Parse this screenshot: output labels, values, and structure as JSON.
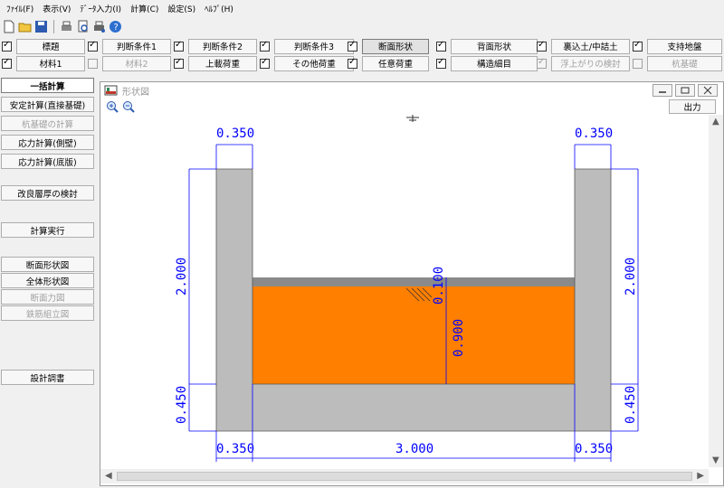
{
  "menu": [
    "ﾌｧｲﾙ(F)",
    "表示(V)",
    "ﾃﾞｰﾀ入力(I)",
    "計算(C)",
    "設定(S)",
    "ﾍﾙﾌﾟ(H)"
  ],
  "toolbar_icons": [
    "new-file-icon",
    "open-folder-icon",
    "save-icon",
    "print-icon",
    "print-preview-icon",
    "printer-setup-icon",
    "help-icon"
  ],
  "options": {
    "row1": [
      {
        "label": "標題",
        "checked": true,
        "disabled": false
      },
      {
        "label": "判断条件1",
        "checked": true,
        "disabled": false
      },
      {
        "label": "判断条件2",
        "checked": true,
        "disabled": false
      },
      {
        "label": "判断条件3",
        "checked": true,
        "disabled": false
      },
      {
        "label": "断面形状",
        "checked": true,
        "disabled": false
      },
      {
        "label": "背面形状",
        "checked": true,
        "disabled": false
      },
      {
        "label": "裏込土/中詰土",
        "checked": true,
        "disabled": false
      },
      {
        "label": "支持地盤",
        "checked": true,
        "disabled": false
      }
    ],
    "row2": [
      {
        "label": "材料1",
        "checked": true,
        "disabled": false
      },
      {
        "label": "材料2",
        "checked": false,
        "disabled": true
      },
      {
        "label": "上載荷重",
        "checked": true,
        "disabled": false
      },
      {
        "label": "その他荷重",
        "checked": true,
        "disabled": false
      },
      {
        "label": "任意荷重",
        "checked": true,
        "disabled": false
      },
      {
        "label": "構造細目",
        "checked": true,
        "disabled": false
      },
      {
        "label": "浮上がりの検討",
        "checked": true,
        "disabled": true
      },
      {
        "label": "杭基礎",
        "checked": false,
        "disabled": true
      }
    ]
  },
  "sidebar": {
    "calc_all": "一括計算",
    "stability_direct": "安定計算(直接基礎)",
    "pile_calc": "杭基礎の計算",
    "stress_wall": "応力計算(側壁)",
    "stress_slab": "応力計算(底版)",
    "improved_layer": "改良層厚の検討",
    "run_calc": "計算実行",
    "section_view": "断面形状図",
    "full_view": "全体形状図",
    "section_force": "断面力図",
    "rebar_view": "鉄筋組立図",
    "design_report": "設計調書"
  },
  "child_window": {
    "title": "形状図",
    "print_label": "出力"
  },
  "drawing": {
    "dims": {
      "top_left": "0.350",
      "top_right": "0.350",
      "left_height": "2.000",
      "right_height": "2.000",
      "left_bottom": "0.450",
      "right_bottom": "0.450",
      "bottom_left": "0.350",
      "bottom_center": "3.000",
      "bottom_right": "0.350",
      "pavement": "0.100",
      "fill_depth": "0.900"
    },
    "colors": {
      "concrete": "#bcbcbc",
      "fill": "#ff7f00",
      "pavement": "#8a8a8a",
      "dimension": "#0000ff"
    }
  }
}
